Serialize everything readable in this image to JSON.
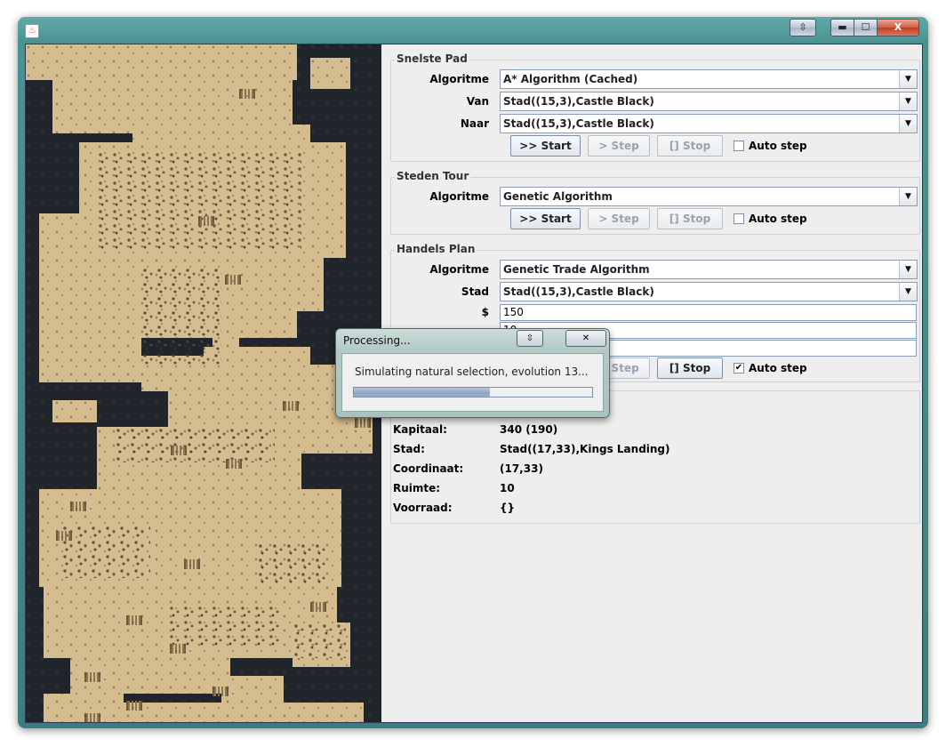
{
  "window": {
    "title": ""
  },
  "titlebar_buttons": {
    "pin": "⇳",
    "minimize": "▬",
    "maximize": "☐",
    "close": "X"
  },
  "snelste_pad": {
    "title": "Snelste Pad",
    "algoritme_label": "Algoritme",
    "algoritme_value": "A* Algorithm (Cached)",
    "van_label": "Van",
    "van_value": "Stad((15,3),Castle Black)",
    "naar_label": "Naar",
    "naar_value": "Stad((15,3),Castle Black)",
    "start": ">> Start",
    "step": "> Step",
    "stop": "[] Stop",
    "auto_step": "Auto step",
    "auto_step_checked": false
  },
  "steden_tour": {
    "title": "Steden Tour",
    "algoritme_label": "Algoritme",
    "algoritme_value": "Genetic Algorithm",
    "start": ">> Start",
    "step": "> Step",
    "stop": "[] Stop",
    "auto_step": "Auto step",
    "auto_step_checked": false
  },
  "handels_plan": {
    "title": "Handels Plan",
    "algoritme_label": "Algoritme",
    "algoritme_value": "Genetic Trade Algorithm",
    "stad_label": "Stad",
    "stad_value": "Stad((15,3),Castle Black)",
    "money_label": "$",
    "money_value": "150",
    "field2_value": "10",
    "field3_value": "",
    "step": "> Step",
    "stop": "[] Stop",
    "auto_step": "Auto step",
    "auto_step_checked": true
  },
  "info": {
    "kapitaal_label": "Kapitaal:",
    "kapitaal_value": "340 (190)",
    "stad_label": "Stad:",
    "stad_value": "Stad((17,33),Kings Landing)",
    "coordinaat_label": "Coordinaat:",
    "coordinaat_value": "(17,33)",
    "ruimte_label": "Ruimte:",
    "ruimte_value": "10",
    "voorraad_label": "Voorraad:",
    "voorraad_value": "{}"
  },
  "dialog": {
    "title": "Processing...",
    "message": "Simulating natural selection, evolution 13...",
    "progress": 0.57
  },
  "colors": {
    "window_frame": "#4a9292",
    "map_water": "#1f252b",
    "map_sand": "#d6bd8f",
    "progress_fill": "#8ea5bf"
  }
}
